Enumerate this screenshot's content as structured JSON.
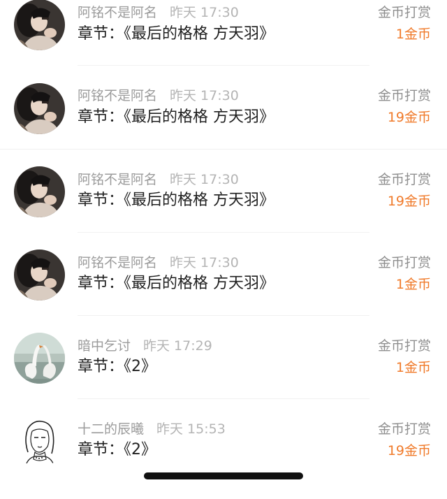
{
  "tips": [
    {
      "user": "阿铭不是阿名",
      "time": "昨天 17:30",
      "chapter": "章节：《最后的格格 方天羽》",
      "tip_label": "金币打赏",
      "amount": "1金币",
      "avatar": "photo-avatar"
    },
    {
      "user": "阿铭不是阿名",
      "time": "昨天 17:30",
      "chapter": "章节：《最后的格格 方天羽》",
      "tip_label": "金币打赏",
      "amount": "19金币",
      "avatar": "photo-avatar"
    },
    {
      "user": "阿铭不是阿名",
      "time": "昨天 17:30",
      "chapter": "章节：《最后的格格 方天羽》",
      "tip_label": "金币打赏",
      "amount": "19金币",
      "avatar": "photo-avatar"
    },
    {
      "user": "阿铭不是阿名",
      "time": "昨天 17:30",
      "chapter": "章节：《最后的格格 方天羽》",
      "tip_label": "金币打赏",
      "amount": "1金币",
      "avatar": "photo-avatar"
    },
    {
      "user": "暗中乞讨",
      "time": "昨天 17:29",
      "chapter": "章节：《2》",
      "tip_label": "金币打赏",
      "amount": "1金币",
      "avatar": "swan-avatar"
    },
    {
      "user": "十二的辰曦",
      "time": "昨天 15:53",
      "chapter": "章节：《2》",
      "tip_label": "金币打赏",
      "amount": "19金币",
      "avatar": "sketch-avatar"
    }
  ],
  "colors": {
    "amount": "#f07a2a",
    "label": "#8f8f8f",
    "name": "#9b9b9b",
    "chapter": "#1f1f1f"
  }
}
